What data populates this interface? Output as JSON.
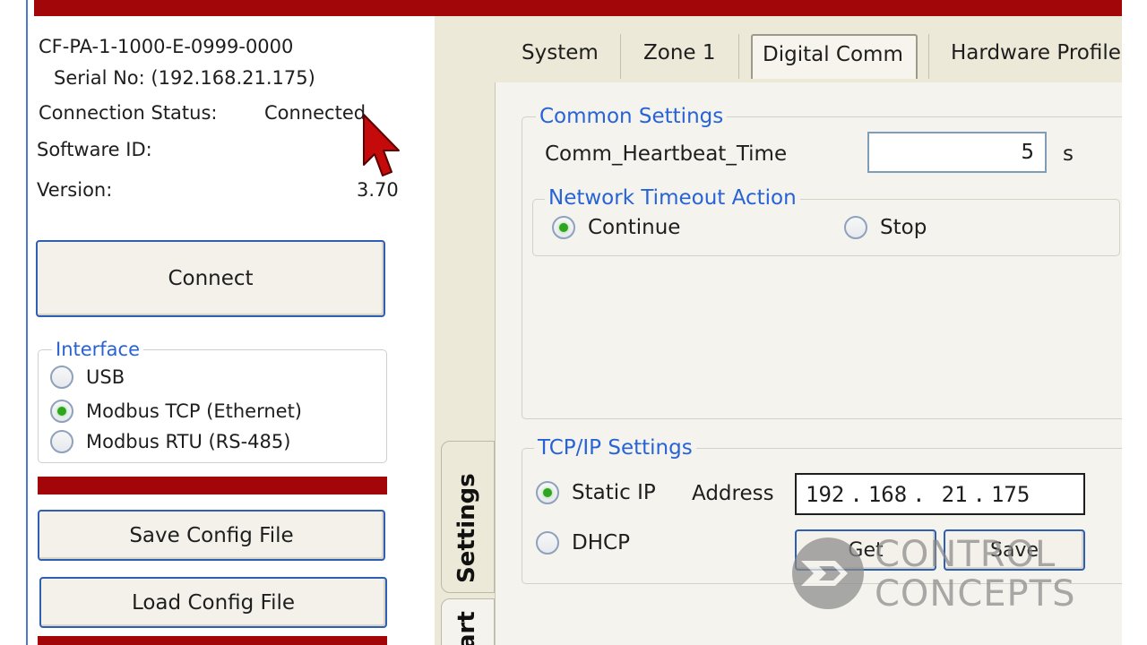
{
  "device": {
    "model": "CF-PA-1-1000-E-0999-0000",
    "serial_line": "Serial No: (192.168.21.175)",
    "connection_status_label": "Connection Status:",
    "connection_status_value": "Connected",
    "software_id_label": "Software ID:",
    "software_id_value": "",
    "version_label": "Version:",
    "version_value": "3.70"
  },
  "left": {
    "connect_label": "Connect",
    "interface": {
      "title": "Interface",
      "options": [
        "USB",
        "Modbus TCP (Ethernet)",
        "Modbus RTU (RS-485)"
      ],
      "selected": "Modbus TCP (Ethernet)"
    },
    "save_config_label": "Save Config File",
    "load_config_label": "Load Config File"
  },
  "tabs": {
    "items": [
      "System",
      "Zone 1",
      "Digital Comm",
      "Hardware Profile"
    ],
    "active": "Digital Comm"
  },
  "vertical_tabs": [
    "Settings",
    "art"
  ],
  "common": {
    "title": "Common Settings",
    "heartbeat_label": "Comm_Heartbeat_Time",
    "heartbeat_value": "5",
    "heartbeat_unit": "s",
    "timeout": {
      "title": "Network Timeout Action",
      "options": [
        "Continue",
        "Stop"
      ],
      "selected": "Continue"
    }
  },
  "tcpip": {
    "title": "TCP/IP Settings",
    "static_label": "Static IP",
    "dhcp_label": "DHCP",
    "selected": "Static IP",
    "address_label": "Address",
    "address_octets": [
      "192",
      "168",
      "21",
      "175"
    ],
    "get_label": "Get",
    "save_label": "Save"
  },
  "watermark": {
    "line1": "CONTROL",
    "line2": "CONCEPTS"
  },
  "colors": {
    "accent_red": "#a30608",
    "legend_blue": "#2763d6",
    "button_border": "#2f5fb3",
    "radio_green": "#2ea41f"
  }
}
